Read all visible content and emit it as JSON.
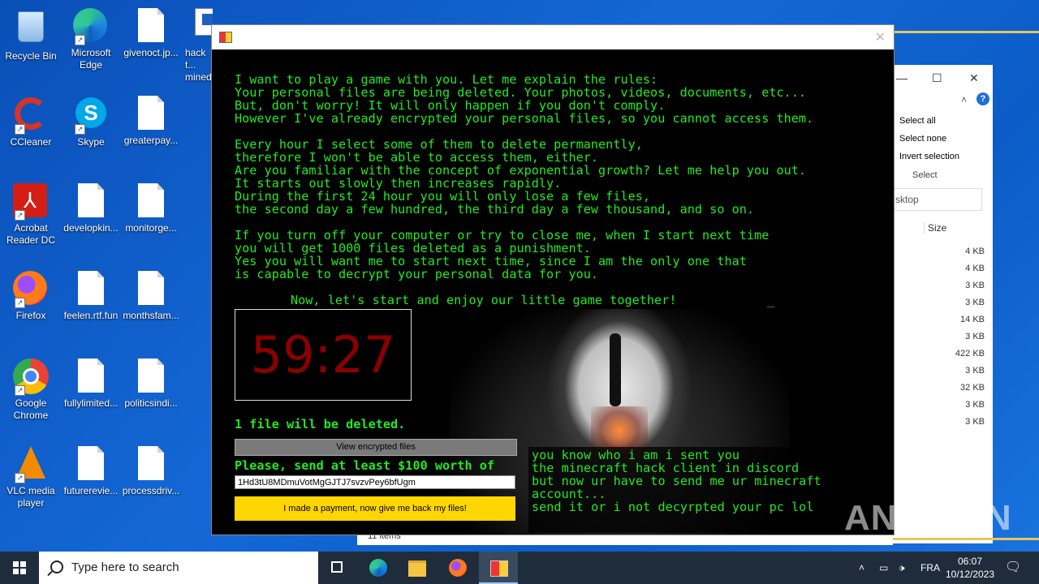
{
  "desktop": {
    "icons": [
      {
        "label": "Recycle Bin",
        "icon": "recycle-bin-icon"
      },
      {
        "label": "Microsoft Edge",
        "icon": "edge-icon"
      },
      {
        "label": "givenoct.jp...",
        "icon": "document-icon"
      },
      {
        "label": "hack t... mined",
        "icon": "app-window-icon"
      },
      {
        "label": "CCleaner",
        "icon": "ccleaner-icon"
      },
      {
        "label": "Skype",
        "icon": "skype-icon"
      },
      {
        "label": "greaterpay...",
        "icon": "document-icon"
      },
      {
        "label": "Acrobat Reader DC",
        "icon": "acrobat-icon"
      },
      {
        "label": "developkin...",
        "icon": "document-icon"
      },
      {
        "label": "monitorge...",
        "icon": "document-icon"
      },
      {
        "label": "Firefox",
        "icon": "firefox-icon"
      },
      {
        "label": "feelen.rtf.fun",
        "icon": "document-icon"
      },
      {
        "label": "monthsfam...",
        "icon": "document-icon"
      },
      {
        "label": "Google Chrome",
        "icon": "chrome-icon"
      },
      {
        "label": "fullylimited...",
        "icon": "document-icon"
      },
      {
        "label": "politicsindi...",
        "icon": "document-icon"
      },
      {
        "label": "VLC media player",
        "icon": "vlc-icon"
      },
      {
        "label": "futurerevie...",
        "icon": "document-icon"
      },
      {
        "label": "processdriv...",
        "icon": "document-icon"
      }
    ]
  },
  "explorer": {
    "select_all": "Select all",
    "select_none": "Select none",
    "invert_selection": "Invert selection",
    "select_group": "Select",
    "address": "sktop",
    "size_header": "Size",
    "sizes": [
      "4 KB",
      "4 KB",
      "3 KB",
      "3 KB",
      "14 KB",
      "3 KB",
      "422 KB",
      "3 KB",
      "32 KB",
      "3 KB",
      "3 KB"
    ],
    "status": "11 items"
  },
  "ransom": {
    "paragraph1": "I want to play a game with you. Let me explain the rules:\nYour personal files are being deleted. Your photos, videos, documents, etc...\nBut, don't worry! It will only happen if you don't comply.\nHowever I've already encrypted your personal files, so you cannot access them.",
    "paragraph2": "Every hour I select some of them to delete permanently,\ntherefore I won't be able to access them, either.\nAre you familiar with the concept of exponential growth? Let me help you out.\nIt starts out slowly then increases rapidly.\nDuring the first 24 hour you will only lose a few files,\nthe second day a few hundred, the third day a few thousand, and so on.",
    "paragraph3": "If you turn off your computer or try to close me, when I start next time\nyou will get 1000 files deleted as a punishment.\nYes you will want me to start next time, since I am the only one that\nis capable to decrypt your personal data for you.",
    "start_line": "Now, let's start and enjoy our little game together!",
    "cursor": "_",
    "timer": "59:27",
    "files_deleted": "1 file will be deleted.",
    "view_button": "View encrypted files",
    "payment_prompt": "Please, send at least $100 worth of",
    "address_value": "1Hd3tU8MDmuVotMgGJTJ7svzvPey6bfUgm",
    "paid_button": "I made a payment, now give me back my files!",
    "chat_text": "you know who i am i sent you\nthe minecraft hack client in discord\nbut now ur have to send me ur minecraft\naccount...\nsend it or i not decyrpted your pc lol"
  },
  "taskbar": {
    "search_placeholder": "Type here to search",
    "language": "FRA",
    "time": "06:07",
    "date": "10/12/2023"
  },
  "watermark": "ANY RUN"
}
